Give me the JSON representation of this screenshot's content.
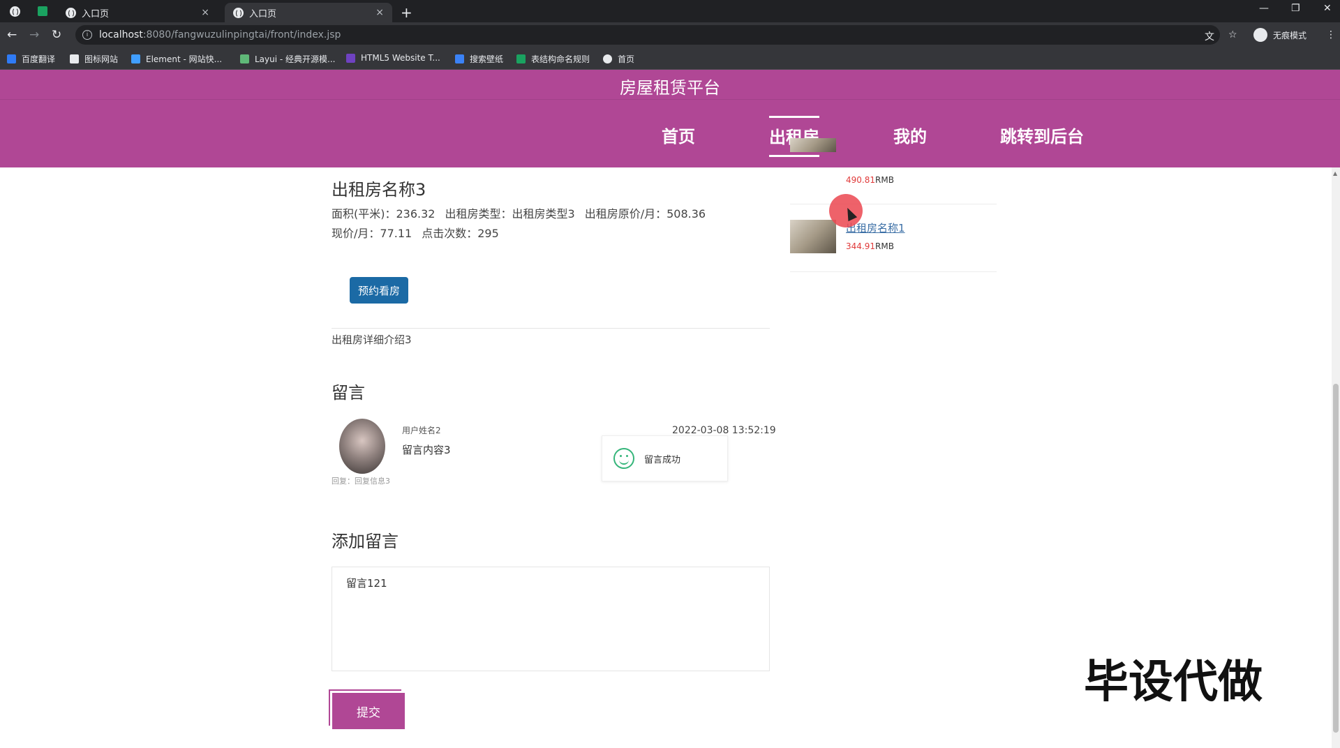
{
  "browser": {
    "tabs": [
      {
        "title": "入口页",
        "active": false
      },
      {
        "title": "入口页",
        "active": true
      }
    ],
    "tab_close": "×",
    "new_tab": "+",
    "url_host": "localhost",
    "url_rest": ":8080/fangwuzulinpingtai/front/index.jsp",
    "incognito_label": "无痕模式",
    "bookmarks": [
      {
        "label": "百度翻译",
        "color": "#2f7bf5"
      },
      {
        "label": "图标网站",
        "color": "#e8eaed"
      },
      {
        "label": "Element - 网站快...",
        "color": "#409eff"
      },
      {
        "label": "Layui - 经典开源模...",
        "color": "#5fb878"
      },
      {
        "label": "HTML5 Website T...",
        "color": "#6f42c1"
      },
      {
        "label": "搜索壁纸",
        "color": "#3b82f6"
      },
      {
        "label": "表结构命名规则",
        "color": "#1aa260"
      },
      {
        "label": "首页",
        "color": "#e8eaed"
      }
    ]
  },
  "site": {
    "title": "房屋租赁平台",
    "brand_color": "#b04795",
    "nav": [
      {
        "label": "首页",
        "active": false
      },
      {
        "label": "出租房",
        "active": true
      },
      {
        "label": "我的",
        "active": false
      },
      {
        "label": "跳转到后台",
        "active": false
      }
    ]
  },
  "detail": {
    "name": "出租房名称3",
    "area_label": "面积(平米)：",
    "area": "236.32",
    "type_label": "出租房类型：",
    "type": "出租房类型3",
    "orig_price_label": "出租房原价/月：",
    "orig_price": "508.36",
    "cur_price_label": "现价/月：",
    "cur_price": "77.11",
    "clicks_label": "点击次数：",
    "clicks": "295",
    "book_button": "预约看房",
    "description": "出租房详细介绍3"
  },
  "comments": {
    "heading": "留言",
    "items": [
      {
        "user": "用户姓名2",
        "content": "留言内容3",
        "reply": "回复：回复信息3",
        "time": "2022-03-08 13:52:19"
      }
    ]
  },
  "toast": {
    "message": "留言成功"
  },
  "add_comment": {
    "heading": "添加留言",
    "value": "留言121",
    "submit": "提交"
  },
  "recommend": [
    {
      "name": "",
      "price": "490.81",
      "unit": "RMB"
    },
    {
      "name": "出租房名称1",
      "price": "344.91",
      "unit": "RMB"
    }
  ],
  "watermark": "毕设代做"
}
